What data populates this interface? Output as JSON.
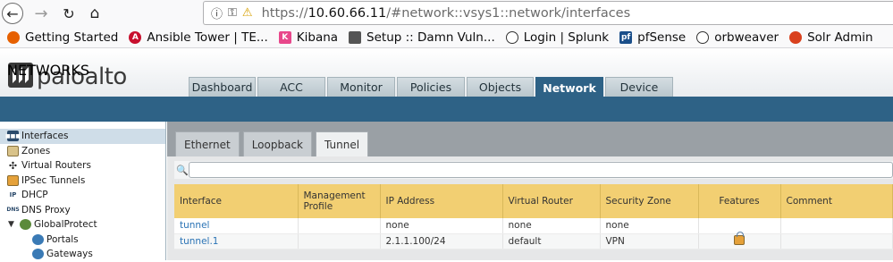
{
  "browser": {
    "url_prefix": "https://",
    "url_host": "10.60.66.11",
    "url_path": "/#network::vsys1::network/interfaces",
    "bookmarks": [
      {
        "label": "Getting Started",
        "icon": "firefox-icon",
        "color": "#e66000"
      },
      {
        "label": "Ansible Tower | TE...",
        "icon": "ansible-icon",
        "color": "#c8102e"
      },
      {
        "label": "Kibana",
        "icon": "kibana-icon",
        "color": "#e8478b"
      },
      {
        "label": "Setup :: Damn Vuln...",
        "icon": "dvwa-icon",
        "color": "#555555"
      },
      {
        "label": "Login | Splunk",
        "icon": "globe-icon",
        "color": "#333333"
      },
      {
        "label": "pfSense",
        "icon": "pfsense-icon",
        "color": "#1b4f8a"
      },
      {
        "label": "orbweaver",
        "icon": "globe-icon",
        "color": "#333333"
      },
      {
        "label": "Solr Admin",
        "icon": "solr-icon",
        "color": "#d9411e"
      }
    ]
  },
  "app": {
    "logo_text": "paloalto",
    "logo_sub": "NETWORKS",
    "top_tabs": [
      "Dashboard",
      "ACC",
      "Monitor",
      "Policies",
      "Objects",
      "Network",
      "Device"
    ],
    "active_top_tab": "Network"
  },
  "sidebar": {
    "items": [
      {
        "label": "Interfaces",
        "icon": "interfaces-icon"
      },
      {
        "label": "Zones",
        "icon": "zones-icon"
      },
      {
        "label": "Virtual Routers",
        "icon": "router-icon"
      },
      {
        "label": "IPSec Tunnels",
        "icon": "tunnel-icon"
      },
      {
        "label": "DHCP",
        "icon": "dhcp-icon"
      },
      {
        "label": "DNS Proxy",
        "icon": "dns-icon"
      },
      {
        "label": "GlobalProtect",
        "icon": "globalprotect-icon"
      },
      {
        "label": "Portals",
        "icon": "portal-icon"
      },
      {
        "label": "Gateways",
        "icon": "gateway-icon"
      }
    ]
  },
  "main": {
    "sub_tabs": [
      "Ethernet",
      "Loopback",
      "Tunnel"
    ],
    "active_sub_tab": "Tunnel",
    "search_value": "",
    "columns": [
      "Interface",
      "Management Profile",
      "IP Address",
      "Virtual Router",
      "Security Zone",
      "Features",
      "Comment"
    ],
    "rows": [
      {
        "interface": "tunnel",
        "mgmt": "",
        "ip": "none",
        "router": "none",
        "zone": "none",
        "features": "",
        "comment": ""
      },
      {
        "interface": "tunnel.1",
        "mgmt": "",
        "ip": "2.1.1.100/24",
        "router": "default",
        "zone": "VPN",
        "features": "lock-icon",
        "comment": ""
      }
    ]
  }
}
